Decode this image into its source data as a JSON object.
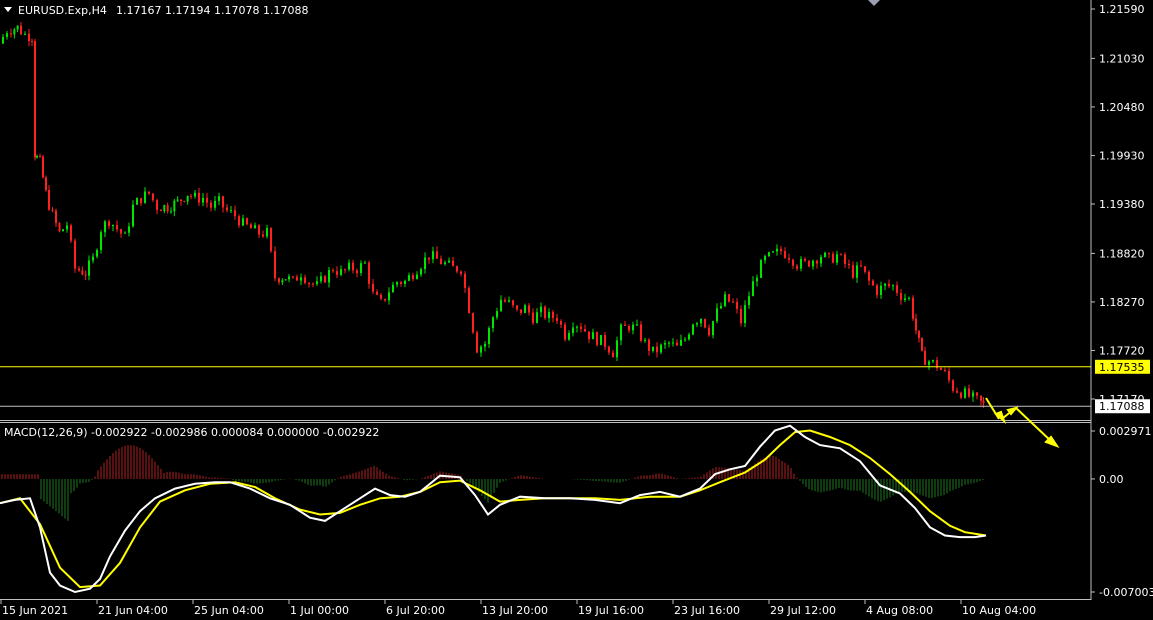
{
  "header": {
    "symbol_timeframe": "EURUSD.Exp,H4",
    "ohlc": "1.17167 1.17194 1.17078 1.17088"
  },
  "price_axis": {
    "labels": [
      "1.21590",
      "1.21030",
      "1.20480",
      "1.19930",
      "1.19380",
      "1.18820",
      "1.18270",
      "1.17720",
      "1.17170"
    ]
  },
  "h_line": {
    "price": 1.17535,
    "label": "1.17535",
    "color": "#ffff00"
  },
  "current_price": {
    "price": 1.17088,
    "label": "1.17088",
    "color": "#ffffff"
  },
  "macd": {
    "header": "MACD(12,26,9) -0.002922 -0.002986 0.000084 0.000000 -0.002922",
    "axis_labels": [
      "0.002971",
      "0.00",
      "-0.007003"
    ]
  },
  "time_axis": {
    "labels": [
      "15 Jun 2021",
      "21 Jun 04:00",
      "25 Jun 04:00",
      "1 Jul 00:00",
      "6 Jul 20:00",
      "13 Jul 20:00",
      "19 Jul 16:00",
      "23 Jul 16:00",
      "29 Jul 12:00",
      "4 Aug 08:00",
      "10 Aug 04:00"
    ]
  },
  "colors": {
    "bull": "#00e600",
    "bear": "#ff2020",
    "macd_line": "#ffffff",
    "signal_line": "#ffff00",
    "hist_pos": "#b02020",
    "hist_neg": "#1e7a1e",
    "arrow": "#ffff00"
  }
}
